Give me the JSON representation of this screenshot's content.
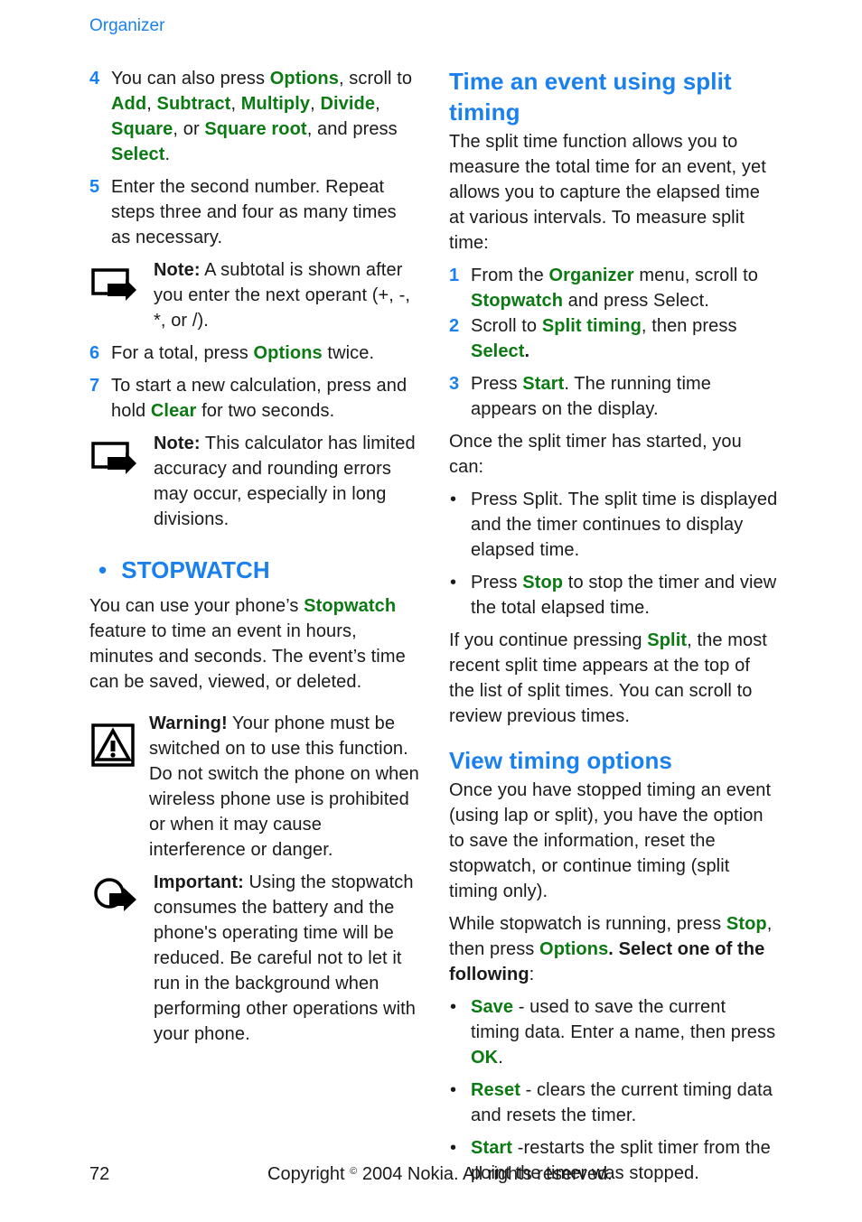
{
  "header": {
    "section": "Organizer"
  },
  "left": {
    "step4": {
      "num": "4",
      "t1": "You can also press ",
      "options": "Options",
      "t2": ", scroll to ",
      "add": "Add",
      "c1": ", ",
      "subtract": "Subtract",
      "c2": ", ",
      "multiply": "Multiply",
      "c3": ", ",
      "divide": "Divide",
      "c4": ", ",
      "square": "Square",
      "t3": ", or ",
      "square_root": "Square root",
      "t4": ", and press ",
      "select": "Select",
      "t5": "."
    },
    "step5": {
      "num": "5",
      "text": "Enter the second number. Repeat steps three and four as many times as necessary."
    },
    "note1": {
      "label": "Note:",
      "text": " A subtotal is shown after you enter the next operant (+, -, *, or /)."
    },
    "step6": {
      "num": "6",
      "t1": "For a total, press ",
      "options": "Options",
      "t2": " twice."
    },
    "step7": {
      "num": "7",
      "t1": "To start a new calculation, press and hold ",
      "clear": "Clear",
      "t2": " for two seconds."
    },
    "note2": {
      "label": "Note:",
      "text": " This calculator has limited accuracy and rounding errors may occur, especially in long divisions."
    },
    "stopwatch": {
      "bullet": "•",
      "title": "STOPWATCH",
      "t1": "You can use your phone’s ",
      "stopwatch": "Stopwatch",
      "t2": " feature to time an event in hours, minutes and seconds. The event’s time can be saved, viewed, or deleted."
    },
    "warning": {
      "label": "Warning!",
      "text": " Your phone must be switched on to use this function. Do not switch the phone on when wireless phone use is prohibited or when it may cause interference or danger."
    },
    "important": {
      "label": "Important:",
      "text": " Using the stopwatch consumes the battery and the phone's operating time will be reduced. Be careful not to let it run in the background when performing other operations with your phone."
    }
  },
  "right": {
    "split": {
      "title": "Time an event using split timing",
      "intro": "The split time function allows you to measure the total time for an event, yet allows you to capture the elapsed time at various intervals. To measure split time:",
      "step1": {
        "num": "1",
        "t1": "From the ",
        "organizer": "Organizer",
        "t2": " menu, scroll to ",
        "stopwatch": "Stopwatch",
        "t3": " and press Select."
      },
      "step2": {
        "num": "2",
        "t1": "Scroll to ",
        "split_timing": "Split timing",
        "t2": ", then press ",
        "select": "Select",
        "t3": "."
      },
      "step3": {
        "num": "3",
        "t1": "Press ",
        "start": "Start",
        "t2": ". The running time appears on the display."
      },
      "once": "Once the split timer has started, you can:",
      "b1": {
        "bullet": "•",
        "text": "Press Split. The split time is displayed and the timer continues to display elapsed time."
      },
      "b2": {
        "bullet": "•",
        "t1": "Press ",
        "stop": "Stop",
        "t2": " to stop the timer and view the total elapsed time."
      },
      "cont": {
        "t1": "If you continue pressing ",
        "split": "Split",
        "t2": ", the most recent split time appears at the top of the list of split times. You can scroll to review previous times."
      }
    },
    "view": {
      "title": "View timing options",
      "intro": "Once you have stopped timing an event (using lap or split), you have the option to save the information, reset the stopwatch, or continue timing (split timing only).",
      "while": {
        "t1": "While stopwatch is running, press ",
        "stop": "Stop",
        "t2": ", then press ",
        "options": "Options",
        "t3": ". Select one of the following",
        "t4": ":"
      },
      "b1": {
        "bullet": "•",
        "save": "Save",
        "t1": " - used to save the current timing data. Enter a name, then press ",
        "ok": "OK",
        "t2": "."
      },
      "b2": {
        "bullet": "•",
        "reset": "Reset",
        "t1": " - clears the current timing data and resets the timer."
      },
      "b3": {
        "bullet": "•",
        "start": "Start",
        "t1": " -restarts the split timer from the point the timer was stopped."
      }
    }
  },
  "footer": {
    "page": "72",
    "copy1": "Copyright ",
    "copy_sym": "©",
    "copy2": " 2004 Nokia. All rights reserved."
  },
  "colors": {
    "heading_blue": "#1a80f0",
    "keyword_green": "#0b7a12",
    "text": "#1a1a1a"
  }
}
